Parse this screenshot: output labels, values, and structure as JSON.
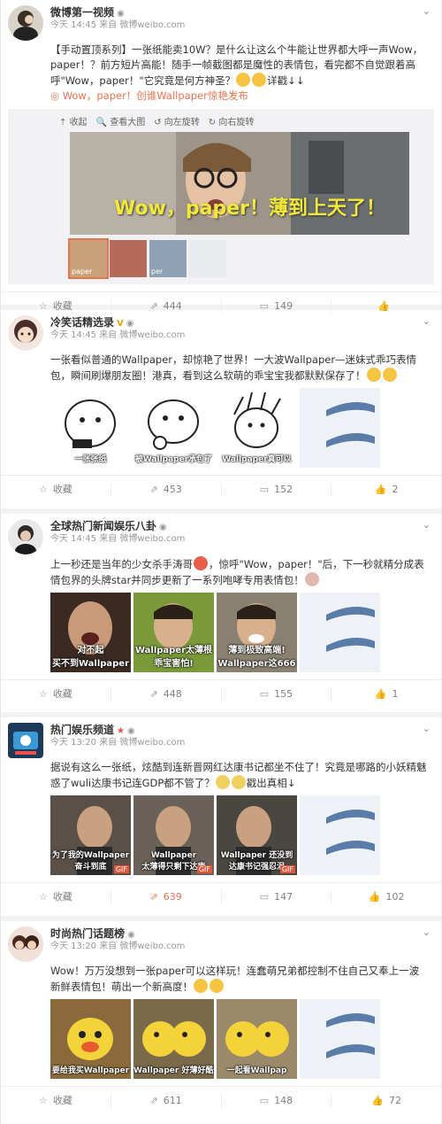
{
  "posts": [
    {
      "author": "微博第一视频",
      "badge": "",
      "time": "今天 14:45",
      "source_prefix": "来自",
      "source": "微博weibo.com",
      "text": "【手动置顶系列】一张纸能卖10W？是什么让这么个牛能让世界都大呼一声Wow，paper！？前方短片高能！随手一帧截图都是魔性的表情包，看完都不自觉跟着高呼\"Wow，paper！\"它究竟是何方神圣？",
      "text_tail": "详戳↓↓",
      "link": "Wow，paper！创谁Wallpaper惊艳发布",
      "media_tools": [
        "收起",
        "查看大图",
        "向左旋转",
        "向右旋转"
      ],
      "big_caption": "Wow，paper！薄到上天了！",
      "small_captions": [
        "paper",
        "",
        "per",
        ""
      ],
      "actions": {
        "fav": "收藏",
        "repost": "444",
        "comment": "149",
        "like": ""
      }
    },
    {
      "author": "冷笑话精选录",
      "badge": "V",
      "time": "今天 14:45",
      "source_prefix": "来自",
      "source": "微博weibo.com",
      "text": "一张看似普通的Wallpaper，却惊艳了世界！一大波Wallpaper—迷妹式乖巧表情包，瞬间刷爆朋友圈！港真，看到这么软萌的乖宝宝我都默默保存了！",
      "captions": [
        "一张张纸",
        "被Wallpaper承包了",
        "Wallpaper真可以",
        ""
      ],
      "actions": {
        "fav": "收藏",
        "repost": "453",
        "comment": "152",
        "like": "2"
      }
    },
    {
      "author": "全球热门新闻娱乐八卦",
      "badge": "",
      "time": "今天 14:45",
      "source_prefix": "来自",
      "source": "微博weibo.com",
      "text": "上一秒还是当年的少女杀手涛哥",
      "text_tail": "，惊呼\"Wow，paper！\"后，下一秒就精分成表情包界的头牌star并同步更新了一系列咆哮专用表情包！",
      "captions": [
        "对不起\n买不到Wallpaper",
        "Wallpaper太薄根\n乖宝害怕!",
        "薄到极致高端!\nWallpaper这666",
        ""
      ],
      "actions": {
        "fav": "收藏",
        "repost": "448",
        "comment": "155",
        "like": "1"
      }
    },
    {
      "author": "热门娱乐频道",
      "badge": "★",
      "time": "今天 13:20",
      "source_prefix": "来自",
      "source": "微博weibo.com",
      "text": "据说有这么一张纸，炫酷到连新晋网红达康书记都坐不住了！究竟是哪路的小妖精魅惑了wuli达康书记连GDP都不管了？",
      "text_tail": "戳出真相↓",
      "captions": [
        "为了我的Wallpaper\n奋斗到底",
        "Wallpaper\n太薄得只剩下达康",
        "Wallpaper 还没到\n达康书记强忍泪",
        ""
      ],
      "actions": {
        "fav": "收藏",
        "repost": "639",
        "comment": "147",
        "like": "102"
      }
    },
    {
      "author": "时尚热门话题榜",
      "badge": "",
      "time": "今天 13:20",
      "source_prefix": "来自",
      "source": "微博weibo.com",
      "text": "Wow！万万没想到一张paper可以这样玩！连蠢萌兄弟都控制不住自己又奉上一波新鲜表情包！萌出一个新高度！",
      "captions": [
        "要给我买Wallpaper",
        "Wallpaper 好薄好酷炫",
        "一起看Wallpap",
        ""
      ],
      "actions": {
        "fav": "收藏",
        "repost": "611",
        "comment": "148",
        "like": "72"
      }
    }
  ]
}
